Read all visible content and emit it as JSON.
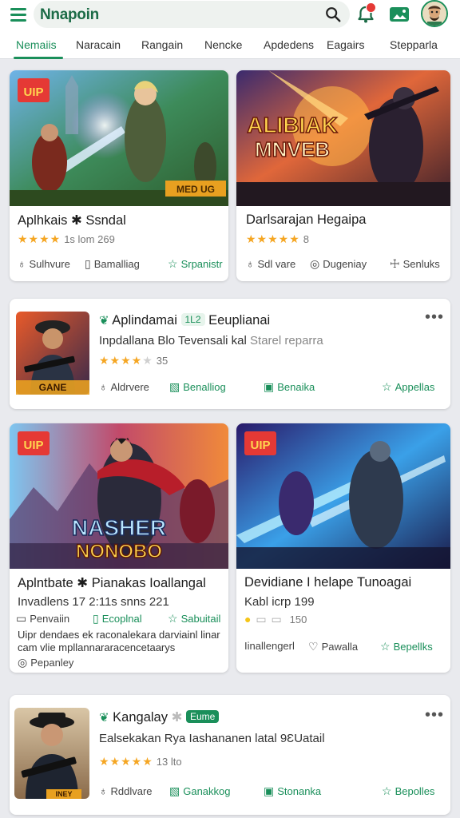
{
  "header": {
    "brand": "Nnapoin",
    "icons": [
      "menu-icon",
      "search-icon",
      "notification-icon",
      "media-icon",
      "avatar"
    ],
    "accent": "#1a8f5a"
  },
  "tabs": [
    {
      "label": "Nemaiis",
      "active": true
    },
    {
      "label": "Naracain"
    },
    {
      "label": "Rangain"
    },
    {
      "label": "Nencke"
    },
    {
      "label": "Apdedens"
    },
    {
      "label": "Eagairs"
    },
    {
      "label": "Stepparla"
    }
  ],
  "cards": {
    "c1": {
      "badge": "UIP",
      "corner_label": "MED UG",
      "title": "Aplhkais ✱ Ssndal",
      "rating_text": "1s lom 269",
      "actions": [
        "Sulhvure",
        "Bamalliag",
        "Srpanistr"
      ]
    },
    "c2": {
      "art_title_1": "ALIBIAK",
      "art_title_2": "MNVEB",
      "title": "Darlsarajan Hegaipa",
      "rating_text": "8",
      "actions": [
        "Sdl vare",
        "Dugeniay",
        "Senluks"
      ]
    },
    "c3": {
      "thumb_label": "GANE",
      "title": "Aplindamai",
      "tag": "1L2",
      "title_suffix": "Eeuplianai",
      "subtitle": "Inpdallana Blo Tevensali kal",
      "subtitle_muted": "Starel reparra",
      "rating_text": "35",
      "actions": [
        "Aldrvere",
        "Benalliog",
        "Benaika",
        "Appellas"
      ]
    },
    "c4": {
      "badge": "UIP",
      "art_title_1": "NASHER",
      "art_title_2": "NONOBO",
      "title": "Aplntbate ✱ Pianakas Ioallangal",
      "subtitle": "Invadlens 17 2:11s snns 221",
      "actions": [
        "Penvaiin",
        "Ecoplnal",
        "Sabuitail"
      ],
      "description": "Uipr dendaes ek raconalekara darviainl linar cam vlie mpllannararacencetaarys",
      "footer": "Pepanley"
    },
    "c5": {
      "badge": "UIP",
      "title": "Devidiane I helape Tunoagai",
      "subtitle": "Kabl icrp 199",
      "rating_text": "150",
      "actions": [
        "Iinallengerl",
        "Pawalla",
        "Bepellks"
      ]
    },
    "c6": {
      "thumb_label": "INEY",
      "title": "Kangalay",
      "tag": "Eume",
      "subtitle": "Ealsekakan Rya Iashananen latal 9ƐUatail",
      "rating_text": "13 lto",
      "actions": [
        "Rddlvare",
        "Ganakkog",
        "Stonanka",
        "Bepolles"
      ]
    }
  }
}
